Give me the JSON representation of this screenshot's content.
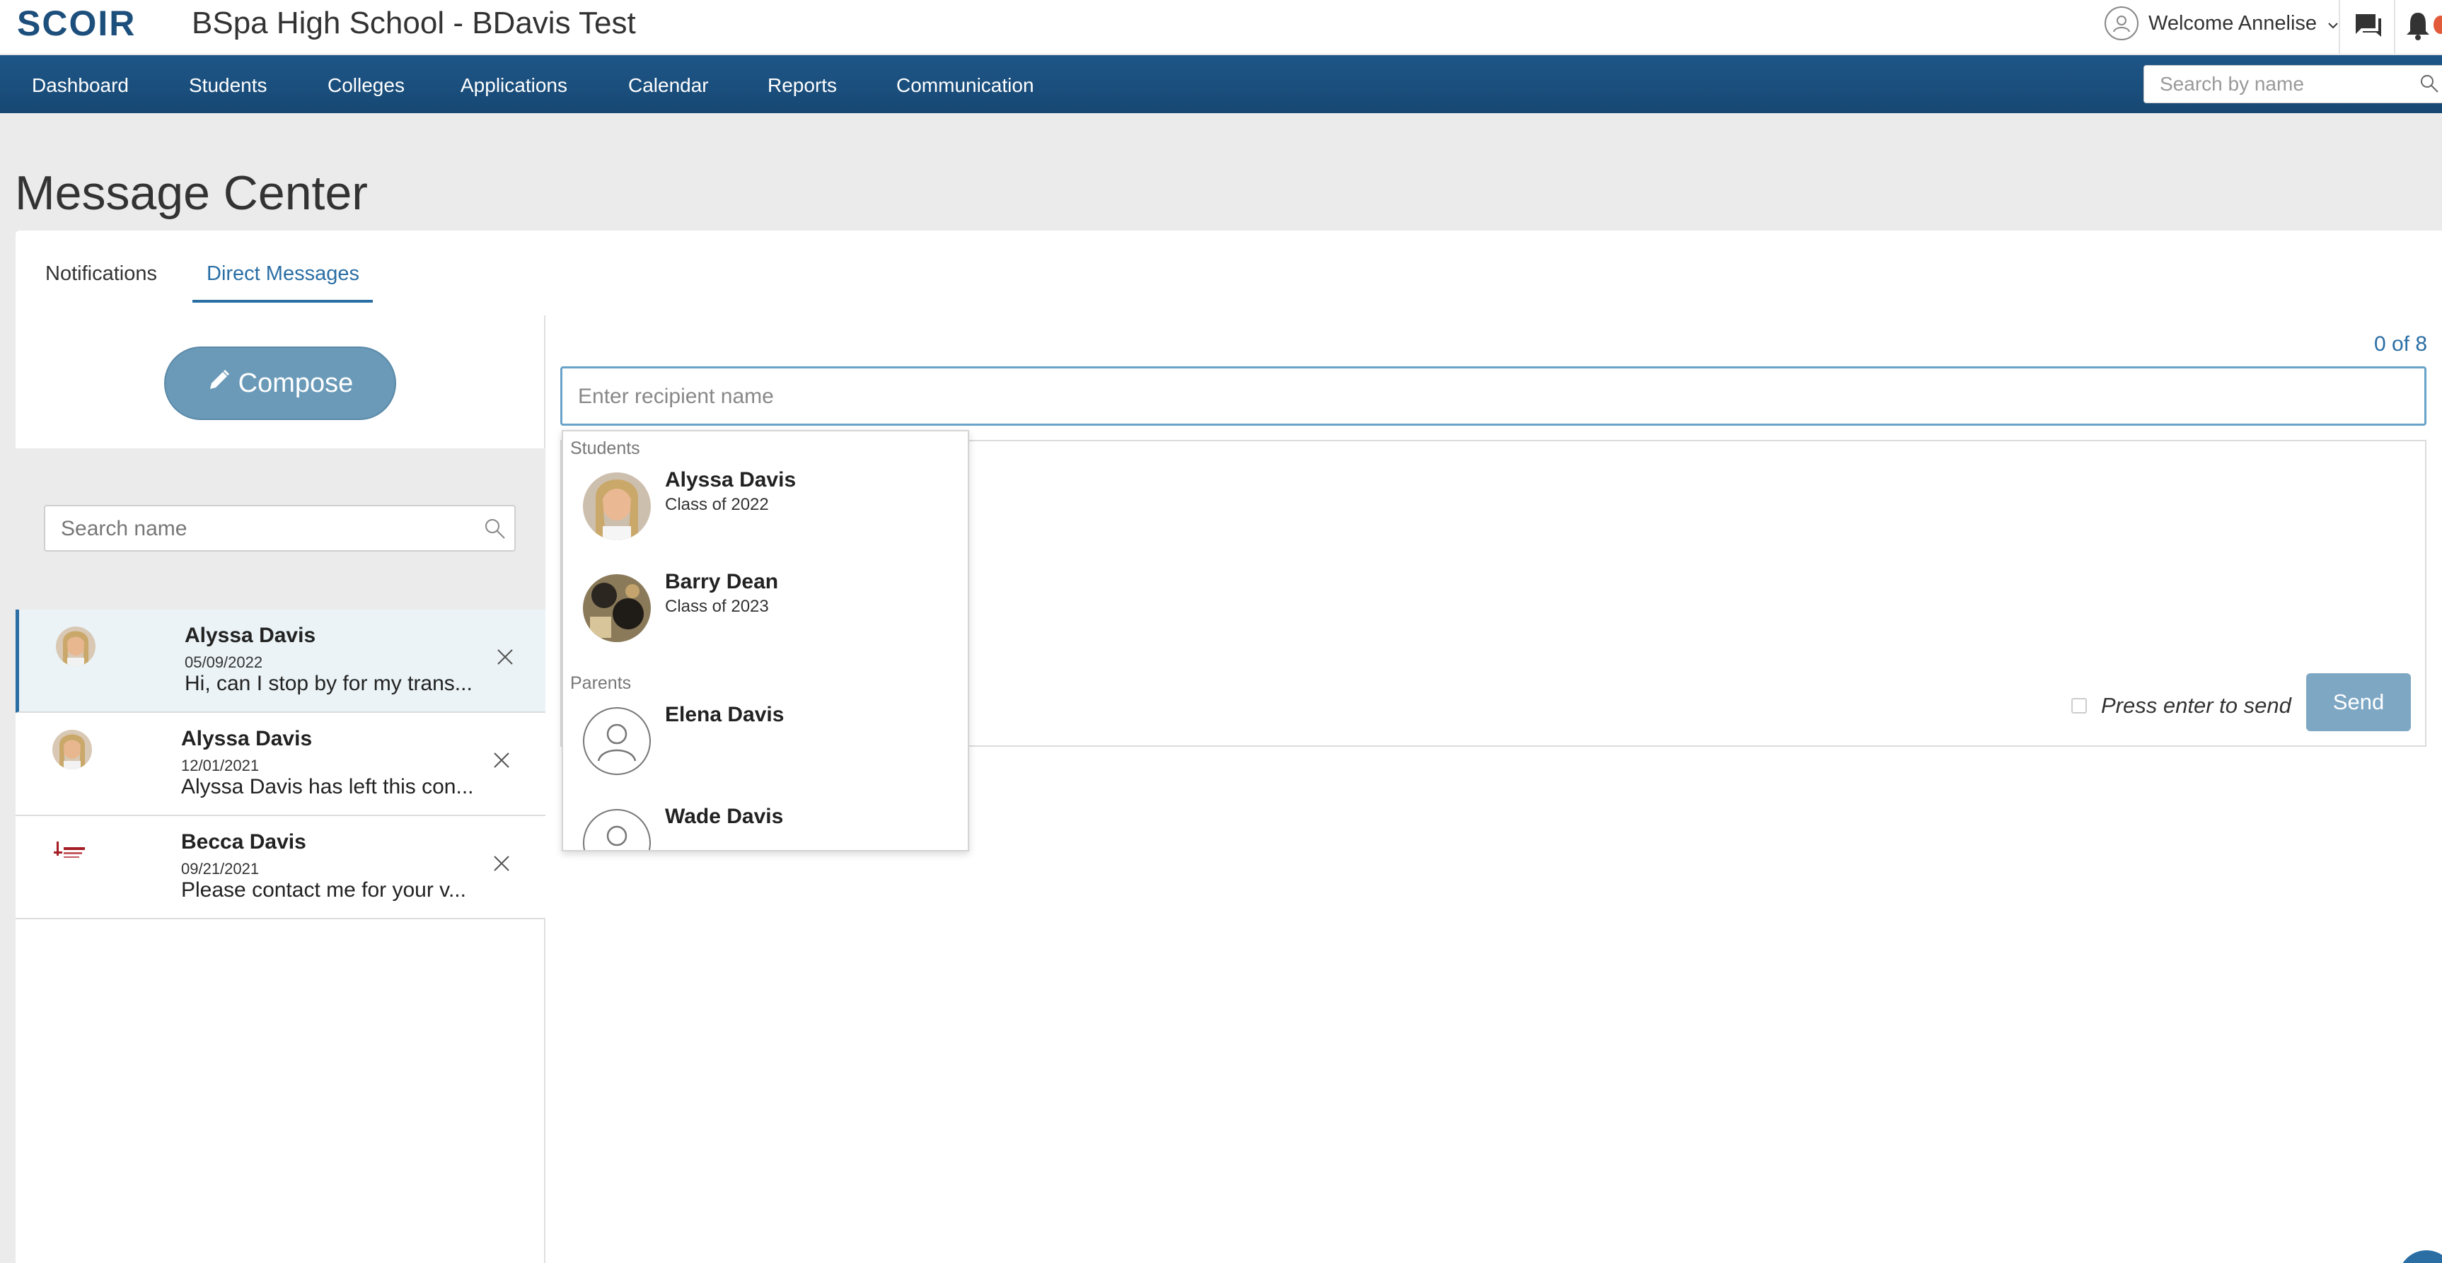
{
  "app": {
    "logo_text": "SCOIR",
    "school_title": "BSpa High School - BDavis Test",
    "welcome_text": "Welcome Annelise"
  },
  "nav": {
    "items": [
      "Dashboard",
      "Students",
      "Colleges",
      "Applications",
      "Calendar",
      "Reports",
      "Communication"
    ],
    "search_placeholder": "Search by name"
  },
  "page": {
    "title": "Message Center"
  },
  "tabs": {
    "notifications": "Notifications",
    "direct_messages": "Direct Messages"
  },
  "left": {
    "compose_label": "Compose",
    "search_placeholder": "Search name",
    "conversations": [
      {
        "name": "Alyssa Davis",
        "date": "05/09/2022",
        "preview": "Hi, can I stop by for my trans..."
      },
      {
        "name": "Alyssa Davis",
        "date": "12/01/2021",
        "preview": "Alyssa Davis has left this con..."
      },
      {
        "name": "Becca Davis",
        "date": "09/21/2021",
        "preview": "Please contact me for your v..."
      }
    ]
  },
  "compose": {
    "counter": "0 of 8",
    "recipient_placeholder": "Enter recipient name",
    "press_enter_label": "Press enter to send",
    "send_label": "Send"
  },
  "dropdown": {
    "students_header": "Students",
    "parents_header": "Parents",
    "students": [
      {
        "name": "Alyssa Davis",
        "sub": "Class of 2022"
      },
      {
        "name": "Barry Dean",
        "sub": "Class of 2023"
      }
    ],
    "parents": [
      {
        "name": "Elena Davis"
      },
      {
        "name": "Wade Davis"
      }
    ]
  },
  "colors": {
    "nav_bg": "#1e5688",
    "accent": "#2a6ea4",
    "compose_bg": "#6a9ab8",
    "send_bg": "#7ea7c4"
  }
}
